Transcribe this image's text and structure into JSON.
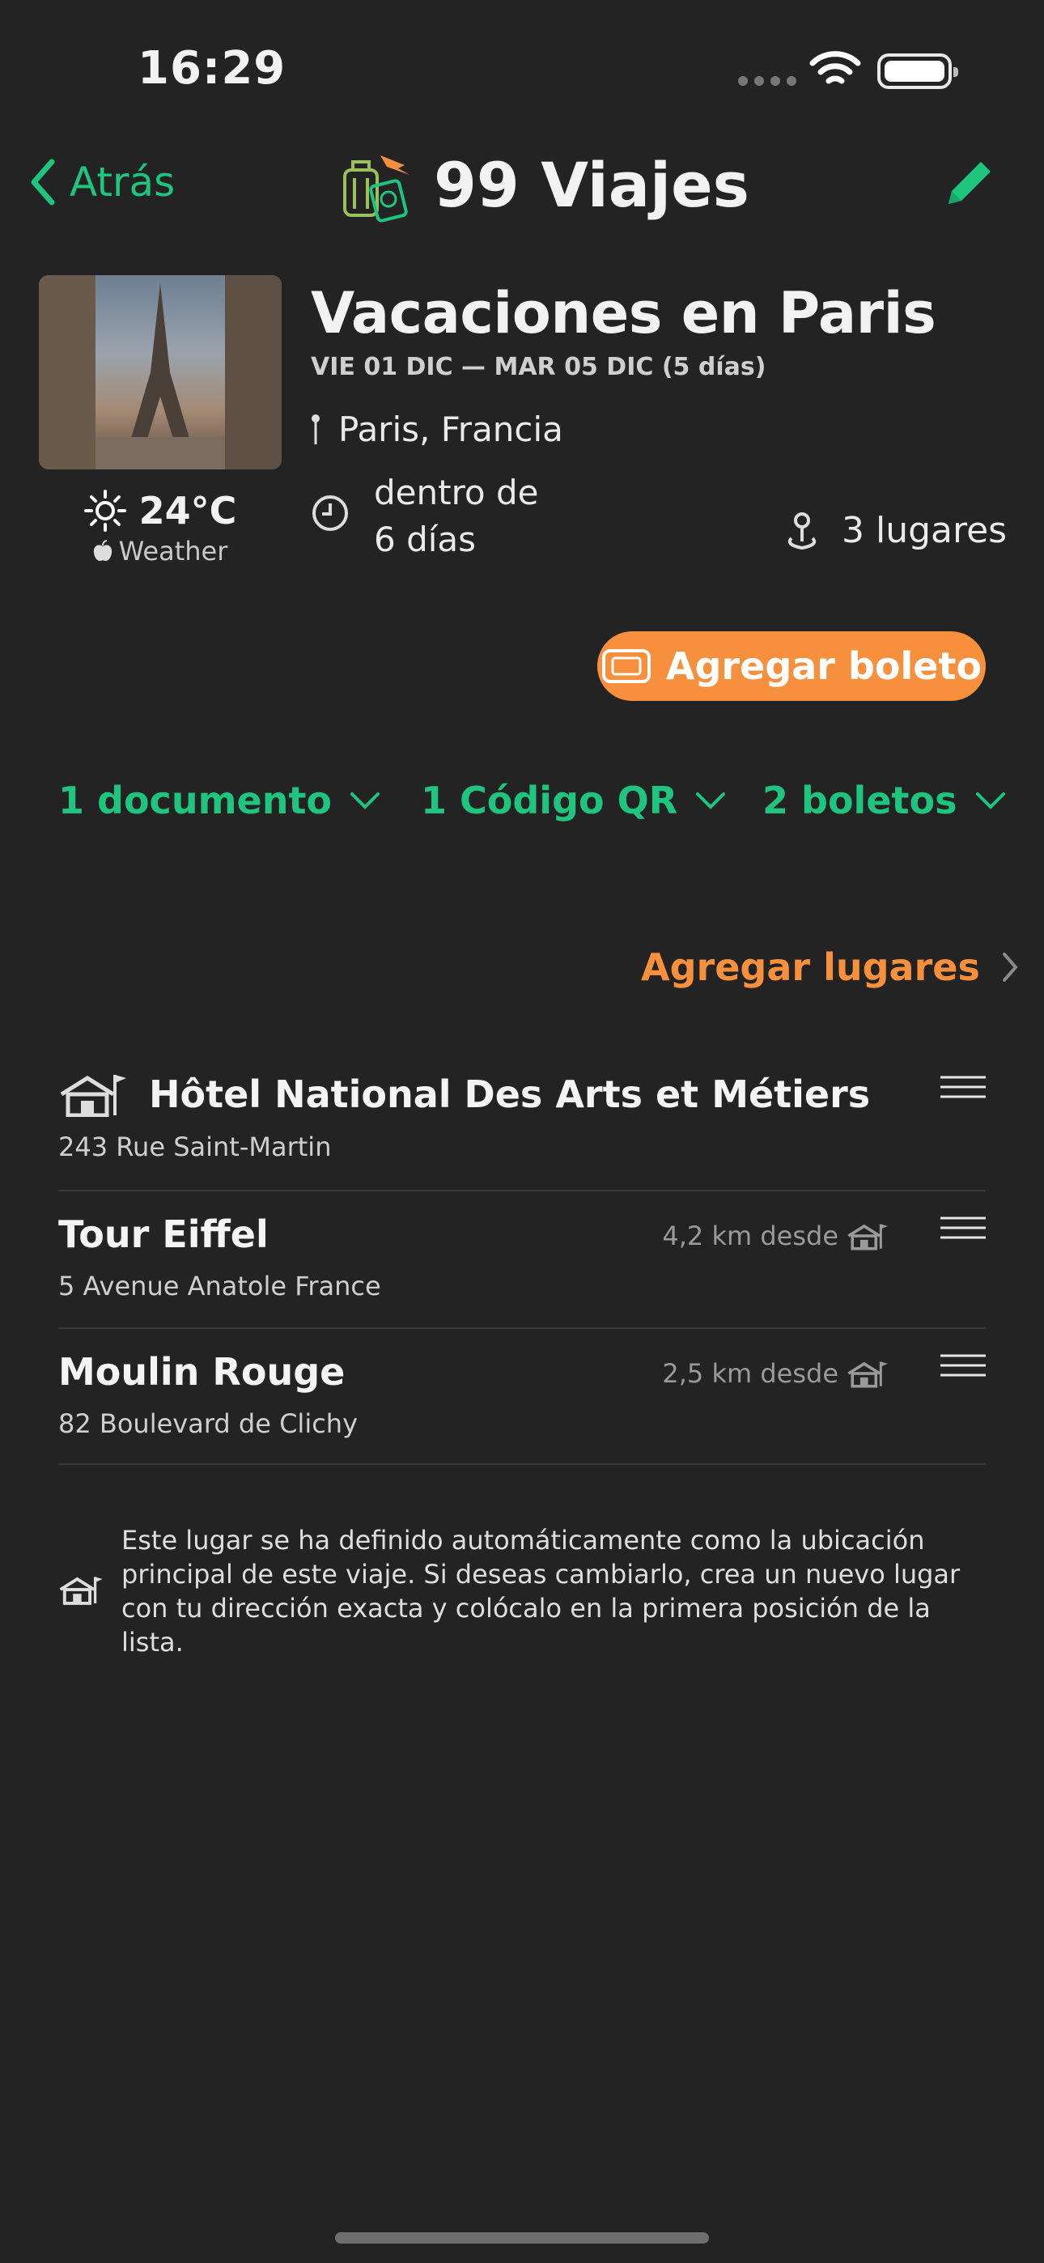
{
  "status_bar": {
    "time": "16:29"
  },
  "nav": {
    "back_label": "Atrás",
    "title": "99 Viajes"
  },
  "trip": {
    "title": "Vacaciones en Paris",
    "dates": "VIE 01 DIC — MAR 05 DIC  (5 días)",
    "location": "Paris, Francia",
    "when_line1": "dentro de",
    "when_line2": "6 días",
    "places_count": "3 lugares",
    "weather_temp": "24°C",
    "weather_source": "Weather"
  },
  "actions": {
    "add_ticket": "Agregar boleto",
    "add_places": "Agregar lugares"
  },
  "chips": {
    "documents": "1 documento",
    "qr": "1 Código QR",
    "tickets": "2 boletos"
  },
  "places": [
    {
      "name": "Hôtel National Des Arts et Métiers",
      "address": "243 Rue Saint-Martin",
      "distance": ""
    },
    {
      "name": "Tour Eiffel",
      "address": "5 Avenue Anatole France",
      "distance": "4,2 km desde"
    },
    {
      "name": "Moulin Rouge",
      "address": "82 Boulevard de Clichy",
      "distance": "2,5 km desde"
    }
  ],
  "note": "Este lugar se ha definido automáticamente como la ubicación principal de este viaje. Si deseas cambiarlo, crea un nuevo lugar con tu dirección exacta y colócalo en la primera posición de la lista.",
  "colors": {
    "accent_green": "#1fc47f",
    "accent_orange": "#f7903c",
    "background": "#232323"
  }
}
